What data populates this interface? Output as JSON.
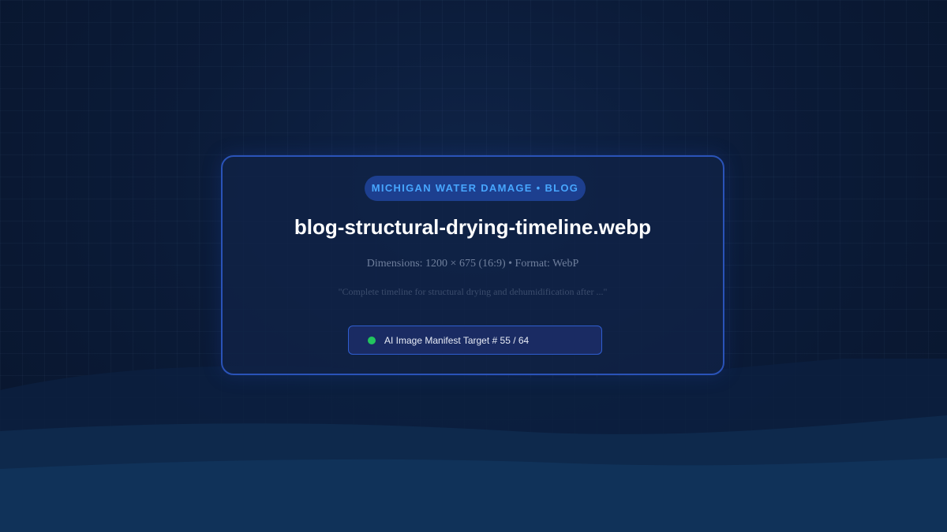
{
  "badge": "MICHIGAN WATER DAMAGE • BLOG",
  "title": "blog-structural-drying-timeline.webp",
  "dimensions": "Dimensions: 1200 × 675 (16:9) • Format: WebP",
  "quote": "\"Complete timeline for structural drying and dehumidification after ...\"",
  "manifest": {
    "label": "AI Image Manifest Target # 55 / 64",
    "status_color": "#22c55e"
  },
  "colors": {
    "background": "#0b1b38",
    "card_border": "#2a53b8",
    "badge_text": "#47a6ff",
    "badge_bg": "#1d3f8f"
  }
}
